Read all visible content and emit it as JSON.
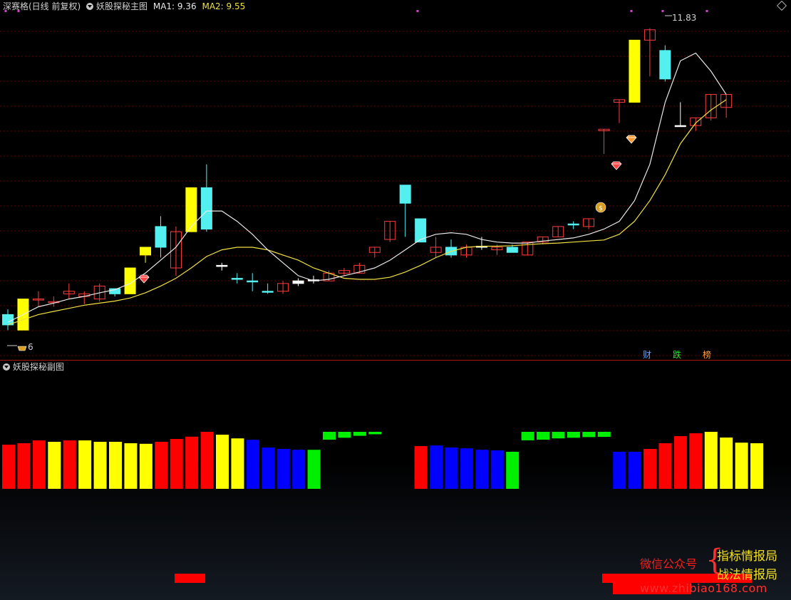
{
  "main_header": {
    "title": "深赛格(日线 前复权)",
    "indicator": "妖股探秘主图",
    "ma1_label": "MA1: 9.36",
    "ma2_label": "MA2: 9.55"
  },
  "sub_header": {
    "indicator": "妖股探秘副图"
  },
  "labels": {
    "high": "11.83",
    "low": "6",
    "tags": [
      "财",
      "跌",
      "榜"
    ]
  },
  "watermark": {
    "left": "微信公众号",
    "brace": "{",
    "right1": "指标情报局",
    "right2": "战法情报局",
    "url": "www.zhibiao168.com"
  },
  "colors": {
    "up": "#ff3c3c",
    "down": "#54f0f0",
    "yellow": "#ffff00",
    "ma1": "#e8e8e8",
    "ma2": "#f0e040",
    "bar_red": "#ff0000",
    "bar_yellow": "#ffff00",
    "bar_blue": "#0000ff",
    "bar_green": "#00ee00",
    "grid": "#6a0000"
  },
  "chart_data": [
    {
      "type": "candlestick",
      "title": "妖股探秘主图",
      "ylim": [
        5.7,
        12.1
      ],
      "ohlc": [
        [
          6.1,
          6.4,
          6.0,
          6.3,
          "c"
        ],
        [
          6.0,
          6.6,
          6.0,
          6.6,
          "y"
        ],
        [
          6.6,
          6.75,
          6.45,
          6.6,
          "u"
        ],
        [
          6.55,
          6.65,
          6.45,
          6.55,
          "u"
        ],
        [
          6.7,
          6.9,
          6.6,
          6.75,
          "u"
        ],
        [
          6.7,
          6.75,
          6.5,
          6.65,
          "u"
        ],
        [
          6.6,
          6.9,
          6.55,
          6.85,
          "u"
        ],
        [
          6.8,
          6.8,
          6.65,
          6.7,
          "c"
        ],
        [
          6.7,
          7.2,
          6.7,
          7.2,
          "y"
        ],
        [
          7.45,
          7.6,
          7.3,
          7.6,
          "y"
        ],
        [
          8.0,
          8.2,
          7.4,
          7.6,
          "c"
        ],
        [
          7.2,
          8.0,
          7.05,
          7.9,
          "u"
        ],
        [
          7.9,
          8.75,
          7.9,
          8.75,
          "y"
        ],
        [
          8.75,
          9.2,
          7.9,
          7.95,
          "c"
        ],
        [
          7.25,
          7.3,
          7.15,
          7.25,
          "d"
        ],
        [
          7.0,
          7.1,
          6.9,
          7.0,
          "c"
        ],
        [
          6.95,
          7.1,
          6.75,
          6.95,
          "c"
        ],
        [
          6.75,
          6.9,
          6.7,
          6.75,
          "c"
        ],
        [
          6.75,
          6.95,
          6.7,
          6.9,
          "u"
        ],
        [
          6.9,
          7.0,
          6.85,
          6.95,
          "d"
        ],
        [
          6.95,
          7.05,
          6.9,
          6.97,
          "d"
        ],
        [
          6.95,
          7.15,
          6.95,
          7.1,
          "u"
        ],
        [
          7.1,
          7.2,
          7.05,
          7.15,
          "u"
        ],
        [
          7.1,
          7.3,
          7.1,
          7.25,
          "u"
        ],
        [
          7.5,
          7.55,
          7.4,
          7.6,
          "u"
        ],
        [
          7.75,
          7.9,
          7.7,
          8.1,
          "u"
        ],
        [
          8.8,
          8.8,
          7.8,
          8.45,
          "c"
        ],
        [
          8.15,
          8.1,
          7.7,
          7.7,
          "c"
        ],
        [
          7.5,
          7.8,
          7.4,
          7.6,
          "u"
        ],
        [
          7.6,
          7.75,
          7.4,
          7.45,
          "c"
        ],
        [
          7.45,
          7.65,
          7.4,
          7.6,
          "u"
        ],
        [
          7.6,
          7.8,
          7.55,
          7.62,
          "d"
        ],
        [
          7.55,
          7.65,
          7.45,
          7.6,
          "u"
        ],
        [
          7.6,
          7.65,
          7.55,
          7.5,
          "c"
        ],
        [
          7.45,
          7.7,
          7.45,
          7.7,
          "u"
        ],
        [
          7.7,
          7.75,
          7.65,
          7.8,
          "u"
        ],
        [
          7.8,
          8.0,
          7.8,
          8.0,
          "u"
        ],
        [
          8.05,
          8.1,
          7.95,
          8.05,
          "c"
        ],
        [
          8.0,
          8.15,
          7.95,
          8.15,
          "u"
        ],
        [
          9.85,
          9.85,
          9.4,
          9.88,
          "u"
        ],
        [
          10.4,
          10.4,
          10.0,
          10.45,
          "u"
        ],
        [
          10.4,
          11.6,
          10.4,
          11.6,
          "y"
        ],
        [
          11.6,
          11.83,
          10.9,
          11.8,
          "u"
        ],
        [
          11.4,
          11.5,
          10.8,
          10.85,
          "c"
        ],
        [
          9.95,
          10.4,
          9.95,
          9.95,
          "d"
        ],
        [
          9.95,
          10.05,
          9.85,
          10.1,
          "u"
        ],
        [
          10.1,
          10.55,
          10.05,
          10.55,
          "u"
        ],
        [
          10.3,
          10.55,
          10.1,
          10.55,
          "u"
        ]
      ],
      "ma1": [
        6.15,
        6.3,
        6.45,
        6.52,
        6.6,
        6.65,
        6.72,
        6.78,
        6.9,
        7.1,
        7.35,
        7.6,
        8.0,
        8.3,
        8.3,
        8.1,
        7.85,
        7.55,
        7.3,
        7.05,
        6.95,
        6.98,
        7.05,
        7.12,
        7.2,
        7.35,
        7.55,
        7.75,
        7.85,
        7.88,
        7.85,
        7.75,
        7.7,
        7.68,
        7.68,
        7.72,
        7.75,
        7.78,
        7.85,
        7.95,
        8.1,
        8.5,
        9.2,
        10.4,
        11.2,
        11.35,
        11.0,
        10.55
      ],
      "ma2": [
        6.1,
        6.2,
        6.3,
        6.36,
        6.42,
        6.48,
        6.52,
        6.56,
        6.62,
        6.72,
        6.85,
        7.0,
        7.2,
        7.42,
        7.55,
        7.6,
        7.6,
        7.55,
        7.45,
        7.35,
        7.2,
        7.1,
        7.0,
        6.98,
        6.98,
        7.02,
        7.12,
        7.25,
        7.4,
        7.52,
        7.6,
        7.62,
        7.62,
        7.63,
        7.65,
        7.67,
        7.68,
        7.7,
        7.72,
        7.74,
        7.85,
        8.1,
        8.5,
        9.0,
        9.6,
        10.0,
        10.25,
        10.45
      ]
    },
    {
      "type": "bar",
      "title": "妖股探秘副图",
      "ylim": [
        0,
        5
      ],
      "values": [
        1.55,
        1.6,
        1.7,
        1.65,
        1.7,
        1.7,
        1.65,
        1.65,
        1.6,
        1.58,
        1.65,
        1.75,
        1.83,
        2.0,
        1.9,
        1.77,
        1.72,
        1.45,
        1.4,
        1.37,
        1.37,
        -0.5,
        -0.35,
        -0.2,
        -0.08,
        -0.02,
        null,
        1.5,
        1.52,
        1.45,
        1.42,
        1.37,
        1.35,
        1.3,
        -0.55,
        -0.5,
        -0.4,
        -0.35,
        -0.3,
        -0.28,
        1.3,
        1.3,
        1.4,
        1.6,
        1.85,
        1.95,
        2.0,
        1.8,
        1.62,
        1.6
      ],
      "colors": [
        "r",
        "r",
        "r",
        "y",
        "r",
        "y",
        "y",
        "y",
        "y",
        "y",
        "r",
        "r",
        "r",
        "r",
        "y",
        "y",
        "b",
        "b",
        "b",
        "b",
        "g",
        "g",
        "g",
        "g",
        "g",
        null,
        "r",
        "r",
        "b",
        "b",
        "b",
        "b",
        "b",
        "g",
        "g",
        "g",
        "g",
        "g",
        "g",
        "g",
        "b",
        "b",
        "r",
        "r",
        "r",
        "r",
        "y",
        "y",
        "y",
        "y"
      ]
    }
  ]
}
